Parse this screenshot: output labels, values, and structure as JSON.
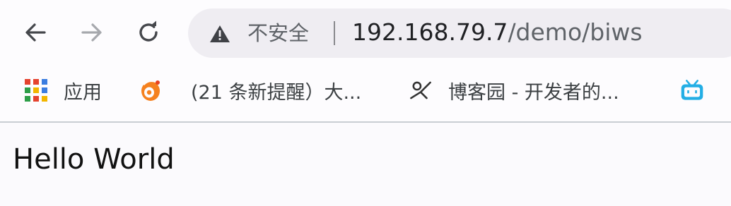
{
  "toolbar": {
    "back_icon": "arrow-left-icon",
    "forward_icon": "arrow-right-icon",
    "reload_icon": "reload-icon"
  },
  "omnibox": {
    "security_icon": "warning-triangle-icon",
    "security_label": "不安全",
    "url_host": "192.168.79.7",
    "url_path": "/demo/biws"
  },
  "bookmarks": {
    "items": [
      {
        "label": "应用",
        "icon": "apps-grid-icon"
      },
      {
        "label": "(21 条新提醒）大...",
        "icon": "weibo-icon"
      },
      {
        "label": "博客园 - 开发者的...",
        "icon": "cnblogs-icon"
      },
      {
        "label": "",
        "icon": "bilibili-icon"
      }
    ]
  },
  "page": {
    "body_text": "Hello World"
  },
  "colors": {
    "toolbar_bg": "#fdfcfe",
    "omnibox_bg": "#efedf2",
    "icon_gray": "#5f6368",
    "bilibili_blue": "#23aee5",
    "weibo_orange": "#f5811f"
  }
}
